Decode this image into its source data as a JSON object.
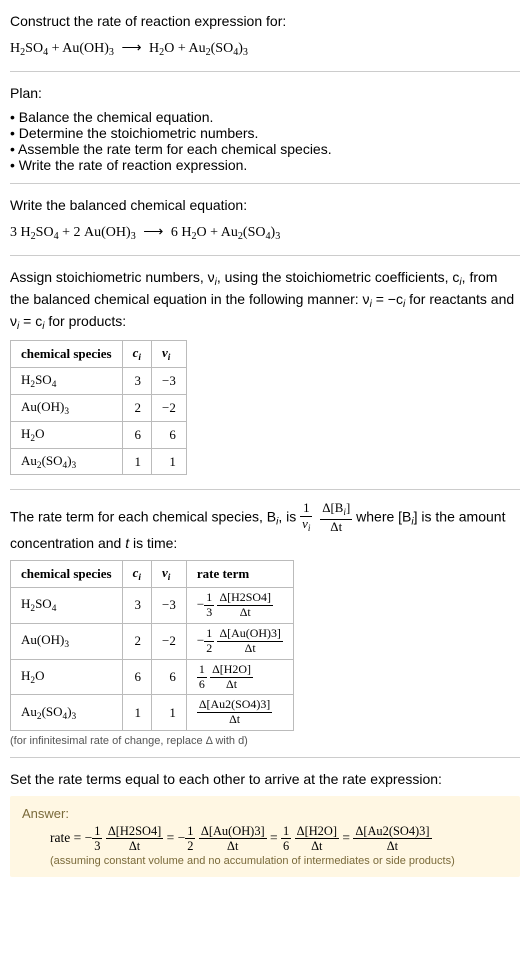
{
  "prompt": {
    "line1": "Construct the rate of reaction expression for:",
    "eq_lhs_1": "H",
    "eq_lhs_1s": "2",
    "eq_lhs_2": "SO",
    "eq_lhs_2s": "4",
    "plus1": " + ",
    "au": "Au(OH)",
    "au_s": "3",
    "arrow": "⟶",
    "h2o": "H",
    "h2o_s": "2",
    "h2o_o": "O",
    "plus2": " + ",
    "prod": "Au",
    "prod_s": "2",
    "prod_so4": "(SO",
    "prod_so4s": "4",
    "prod_close": ")",
    "prod_3": "3"
  },
  "plan": {
    "header": "Plan:",
    "items": [
      "Balance the chemical equation.",
      "Determine the stoichiometric numbers.",
      "Assemble the rate term for each chemical species.",
      "Write the rate of reaction expression."
    ]
  },
  "balanced": {
    "header": "Write the balanced chemical equation:",
    "c_h2so4": "3",
    "c_auoh3": "2",
    "c_h2o": "6"
  },
  "stoich_intro": {
    "text1": "Assign stoichiometric numbers, ν",
    "i1": "i",
    "text2": ", using the stoichiometric coefficients, c",
    "i2": "i",
    "text3": ", from the balanced chemical equation in the following manner: ν",
    "i3": "i",
    "text4": " = −c",
    "i4": "i",
    "text5": " for reactants and ν",
    "i5": "i",
    "text6": " = c",
    "i6": "i",
    "text7": " for products:"
  },
  "table1": {
    "h1": "chemical species",
    "h2_c": "c",
    "h2_i": "i",
    "h3_nu": "ν",
    "h3_i": "i",
    "rows": [
      {
        "sp": "H2SO4",
        "c": "3",
        "nu": "−3"
      },
      {
        "sp": "Au(OH)3",
        "c": "2",
        "nu": "−2"
      },
      {
        "sp": "H2O",
        "c": "6",
        "nu": "6"
      },
      {
        "sp": "Au2(SO4)3",
        "c": "1",
        "nu": "1"
      }
    ]
  },
  "rate_intro": {
    "t1": "The rate term for each chemical species, B",
    "i1": "i",
    "t2": ", is ",
    "frac1_num": "1",
    "frac1_den_nu": "ν",
    "frac1_den_i": "i",
    "frac2_num_d": "Δ[B",
    "frac2_num_i": "i",
    "frac2_num_c": "]",
    "frac2_den": "Δt",
    "t3": " where [B",
    "i2": "i",
    "t4": "] is the amount concentration and ",
    "tvar": "t",
    "t5": " is time:"
  },
  "table2": {
    "h1": "chemical species",
    "h2_c": "c",
    "h2_i": "i",
    "h3_nu": "ν",
    "h3_i": "i",
    "h4": "rate term",
    "rows": [
      {
        "sp": "H2SO4",
        "c": "3",
        "nu": "−3",
        "coef": "−",
        "fnum": "1",
        "fden": "3",
        "dnum": "Δ[H2SO4]",
        "dden": "Δt"
      },
      {
        "sp": "Au(OH)3",
        "c": "2",
        "nu": "−2",
        "coef": "−",
        "fnum": "1",
        "fden": "2",
        "dnum": "Δ[Au(OH)3]",
        "dden": "Δt"
      },
      {
        "sp": "H2O",
        "c": "6",
        "nu": "6",
        "coef": "",
        "fnum": "1",
        "fden": "6",
        "dnum": "Δ[H2O]",
        "dden": "Δt"
      },
      {
        "sp": "Au2(SO4)3",
        "c": "1",
        "nu": "1",
        "coef": "",
        "fnum": "",
        "fden": "",
        "dnum": "Δ[Au2(SO4)3]",
        "dden": "Δt"
      }
    ],
    "footnote": "(for infinitesimal rate of change, replace Δ with d)"
  },
  "final_header": "Set the rate terms equal to each other to arrive at the rate expression:",
  "answer": {
    "label": "Answer:",
    "rate_word": "rate",
    "eq": " = ",
    "m1": "−",
    "n1": "1",
    "d1": "3",
    "D1n": "Δ[H2SO4]",
    "D1d": "Δt",
    "m2": "−",
    "n2": "1",
    "d2": "2",
    "D2n": "Δ[Au(OH)3]",
    "D2d": "Δt",
    "n3": "1",
    "d3": "6",
    "D3n": "Δ[H2O]",
    "D3d": "Δt",
    "D4n": "Δ[Au2(SO4)3]",
    "D4d": "Δt",
    "assume": "(assuming constant volume and no accumulation of intermediates or side products)"
  }
}
